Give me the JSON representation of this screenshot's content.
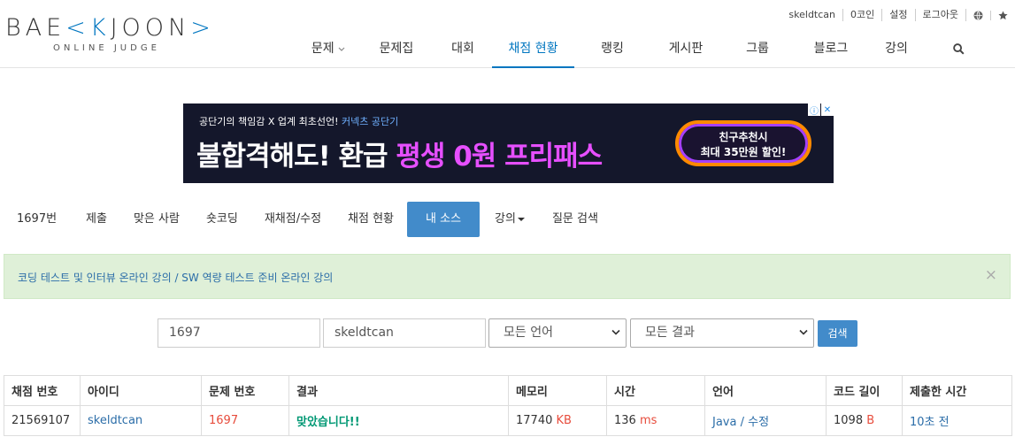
{
  "logo": {
    "main_left": "BAE",
    "main_k": "K",
    "main_right": "JOON",
    "sub": "ONLINE JUDGE"
  },
  "topbar": {
    "user": "skeldtcan",
    "coins": "0코인",
    "settings": "설정",
    "logout": "로그아웃"
  },
  "nav": [
    {
      "label": "문제"
    },
    {
      "label": "문제집"
    },
    {
      "label": "대회"
    },
    {
      "label": "채점 현황"
    },
    {
      "label": "랭킹"
    },
    {
      "label": "게시판"
    },
    {
      "label": "그룹"
    },
    {
      "label": "블로그"
    },
    {
      "label": "강의"
    }
  ],
  "ad": {
    "small": "공단기의 책임감 X 업계 최초선언!",
    "brand": "커넥츠 공단기",
    "big_a": "불합격해도! 환급",
    "big_b": "평생 0원 프리패스",
    "pill_1": "친구추천시",
    "pill_2": "최대 35만원 할인!"
  },
  "subnav": [
    {
      "label": "1697번"
    },
    {
      "label": "제출"
    },
    {
      "label": "맞은 사람"
    },
    {
      "label": "숏코딩"
    },
    {
      "label": "재채점/수정"
    },
    {
      "label": "채점 현황"
    },
    {
      "label": "내 소스"
    },
    {
      "label": "강의"
    },
    {
      "label": "질문 검색"
    }
  ],
  "alert": {
    "text": "코딩 테스트 및 인터뷰 온라인 강의 / SW 역량 테스트 준비 온라인 강의",
    "close": "×"
  },
  "search": {
    "problem_id": "1697",
    "user_id": "skeldtcan",
    "language": "모든 언어",
    "result": "모든 결과",
    "button": "검색"
  },
  "table": {
    "headers": [
      "채점 번호",
      "아이디",
      "문제 번호",
      "결과",
      "메모리",
      "시간",
      "언어",
      "코드 길이",
      "제출한 시간"
    ],
    "rows": [
      {
        "submission": "21569107",
        "user": "skeldtcan",
        "problem": "1697",
        "result": "맞았습니다!!",
        "memory": "17740",
        "memory_unit": "KB",
        "time": "136",
        "time_unit": "ms",
        "language": "Java",
        "edit": "수정",
        "code_length": "1098",
        "code_unit": "B",
        "submitted": "10초 전"
      }
    ]
  },
  "colors": {
    "accent": "#0076c0",
    "button": "#428bca",
    "accepted": "#009874",
    "alert_bg": "#dff0d8"
  }
}
